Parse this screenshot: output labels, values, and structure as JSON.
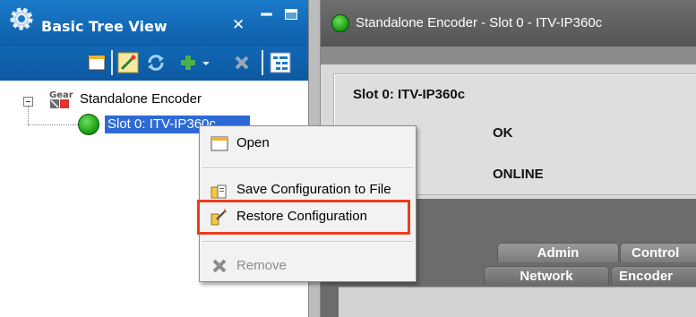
{
  "left_panel": {
    "title": "Basic Tree View",
    "close_glyph": "✕",
    "icons": {
      "title": "gear-cog-icon",
      "toolbar": [
        "new-window-icon",
        "edit-wand-icon",
        "refresh-icon",
        "add-icon",
        "dropdown-arrow-icon",
        "delete-icon",
        "tree-layout-icon"
      ]
    }
  },
  "tree": {
    "root": {
      "label": "Standalone Encoder",
      "icon": "gear-icon"
    },
    "child": {
      "label": "Slot 0: ITV-IP360c",
      "status_color": "#1fa41a"
    }
  },
  "right_panel": {
    "title": "Standalone Encoder - Slot 0 - ITV-IP360c",
    "heading": "Slot 0: ITV-IP360c",
    "status_1": "OK",
    "status_2": "ONLINE",
    "tabs_row1": [
      "Admin",
      "Control"
    ],
    "tabs_row2": [
      "Network",
      "Encoder"
    ]
  },
  "context_menu": {
    "items": [
      {
        "label": "Open",
        "icon": "window-icon",
        "enabled": true
      },
      {
        "label": "Save Configuration to File",
        "icon": "save-config-icon",
        "enabled": true
      },
      {
        "label": "Restore Configuration",
        "icon": "restore-config-icon",
        "enabled": true,
        "highlighted": true
      },
      {
        "label": "Remove",
        "icon": "remove-x-icon",
        "enabled": false
      }
    ],
    "highlight_color": "#ee3b1b"
  },
  "colors": {
    "title_bar": "#1a7ac9",
    "selection": "#2d6ad6",
    "status_green": "#1fa41a"
  }
}
